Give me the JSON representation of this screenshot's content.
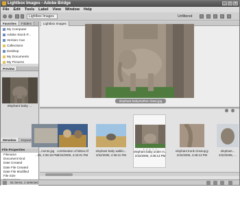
{
  "window": {
    "title": "Lightbox Images - Adobe Bridge",
    "controls": [
      "_",
      "□",
      "×"
    ]
  },
  "menu": [
    "File",
    "Edit",
    "Tools",
    "Label",
    "View",
    "Window",
    "Help"
  ],
  "toolbar": {
    "path": "Lightbox Images",
    "filter": "Unfiltered"
  },
  "left_panel": {
    "favorites_tabs": [
      "Favorites",
      "Folders"
    ],
    "favorites": [
      "My Computer",
      "Adobe Stock P...",
      "Version Cue",
      "Collections",
      "Desktop",
      "My Documents",
      "My Pictures"
    ],
    "preview_tab": "Preview",
    "preview_caption": "elephant baby ...",
    "metadata_tabs": [
      "Metadata",
      "Keywords"
    ],
    "metadata_header": "File Properties",
    "metadata_rows": [
      "Filename",
      "Document Kind",
      "Date Created",
      "Date File Created",
      "Date File Modified",
      "File Size",
      "Dimensions",
      "Resolution"
    ]
  },
  "main": {
    "tab_label": "Lightbox Images",
    "image_caption": "elephant babymother close.jpg"
  },
  "thumbnails": [
    {
      "name": "...ments.jpg",
      "date": "...05, 4:36:18 PM"
    },
    {
      "name": "combination of kitties.tif",
      "date": "2/22/2005, 4:42:01 PM"
    },
    {
      "name": "elephant baby walkin...",
      "date": "2/22/2005, 4:36:11 PM"
    },
    {
      "name": "elephant baby under m...",
      "date": "2/22/2005, 4:36:13 PM"
    },
    {
      "name": "elephant trunk closeup.jpg",
      "date": "2/22/2005, 4:36:13 PM"
    },
    {
      "name": "elephant...",
      "date": "2/22/2005, ..."
    }
  ],
  "status": {
    "text": "51 items, 1 selected"
  },
  "colors": {
    "titlebar": "#4a4a4a",
    "panel": "#d9d9d9",
    "accent_selection": "#f7f7f7"
  }
}
